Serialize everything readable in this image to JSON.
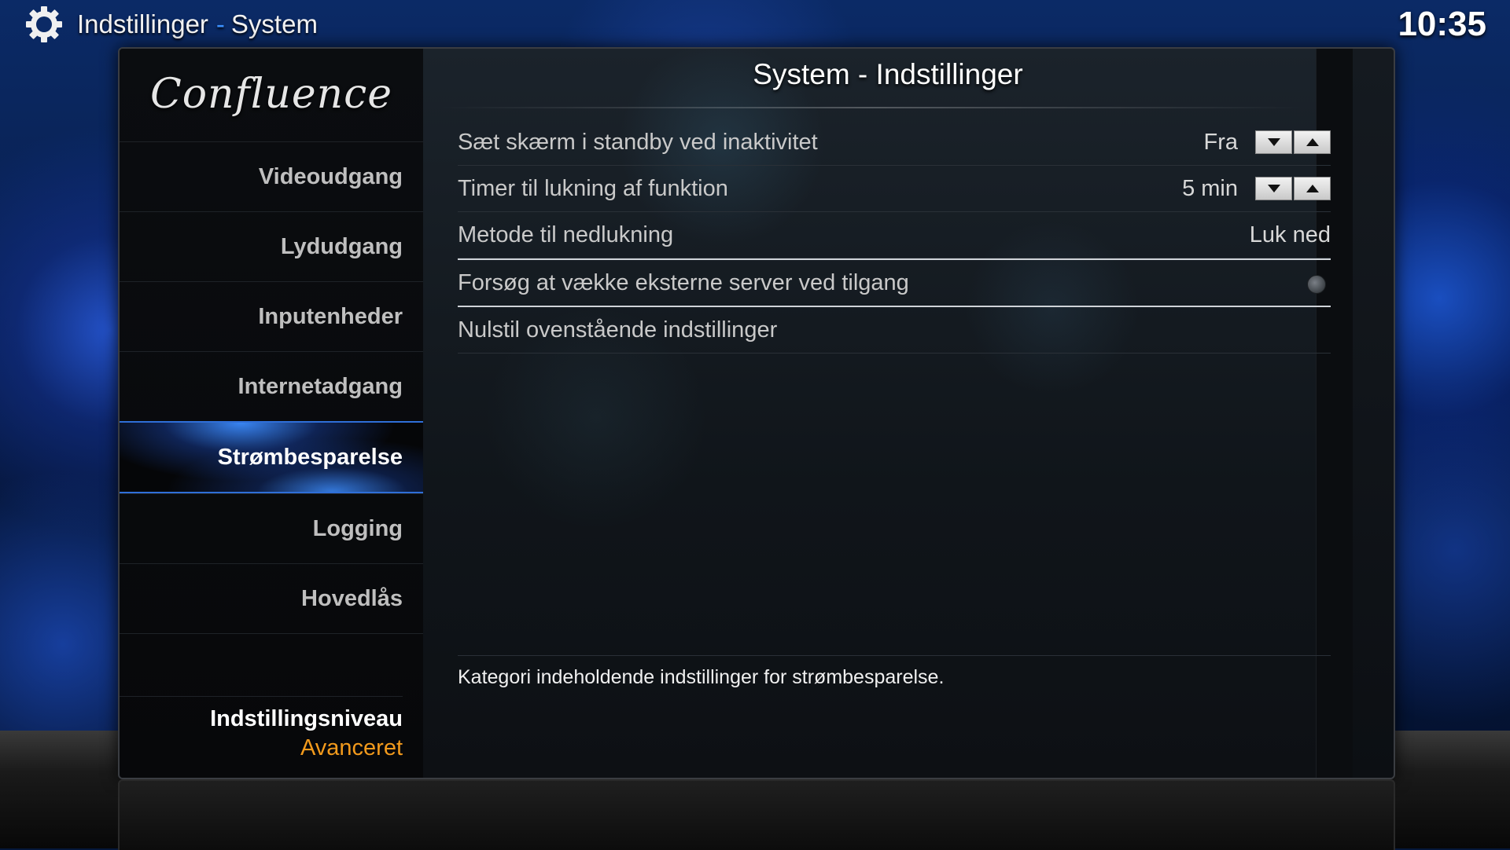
{
  "header": {
    "section": "Indstillinger",
    "separator": "-",
    "page": "System",
    "time": "10:35",
    "icon": "gear-icon"
  },
  "sidebar": {
    "logo": "Confluence",
    "items": [
      {
        "label": "Videoudgang",
        "selected": false
      },
      {
        "label": "Lydudgang",
        "selected": false
      },
      {
        "label": "Inputenheder",
        "selected": false
      },
      {
        "label": "Internetadgang",
        "selected": false
      },
      {
        "label": "Strømbesparelse",
        "selected": true
      },
      {
        "label": "Logging",
        "selected": false
      },
      {
        "label": "Hovedlås",
        "selected": false
      }
    ],
    "settings_level": {
      "label": "Indstillingsniveau",
      "value": "Avanceret"
    }
  },
  "main": {
    "title": "System - Indstillinger",
    "settings": [
      {
        "label": "Sæt skærm i standby ved inaktivitet",
        "value": "Fra",
        "control": "spinner"
      },
      {
        "label": "Timer til lukning af funktion",
        "value": "5 min",
        "control": "spinner"
      },
      {
        "label": "Metode til nedlukning",
        "value": "Luk ned",
        "control": "list"
      },
      {
        "label": "Forsøg at vække eksterne server ved tilgang",
        "control": "radio",
        "checked": false,
        "focused": true
      },
      {
        "label": "Nulstil ovenstående indstillinger",
        "control": "button"
      }
    ],
    "description": "Kategori indeholdende indstillinger for strømbesparelse."
  },
  "colors": {
    "accent": "#2f6fd8",
    "level_value": "#f29a1c"
  }
}
